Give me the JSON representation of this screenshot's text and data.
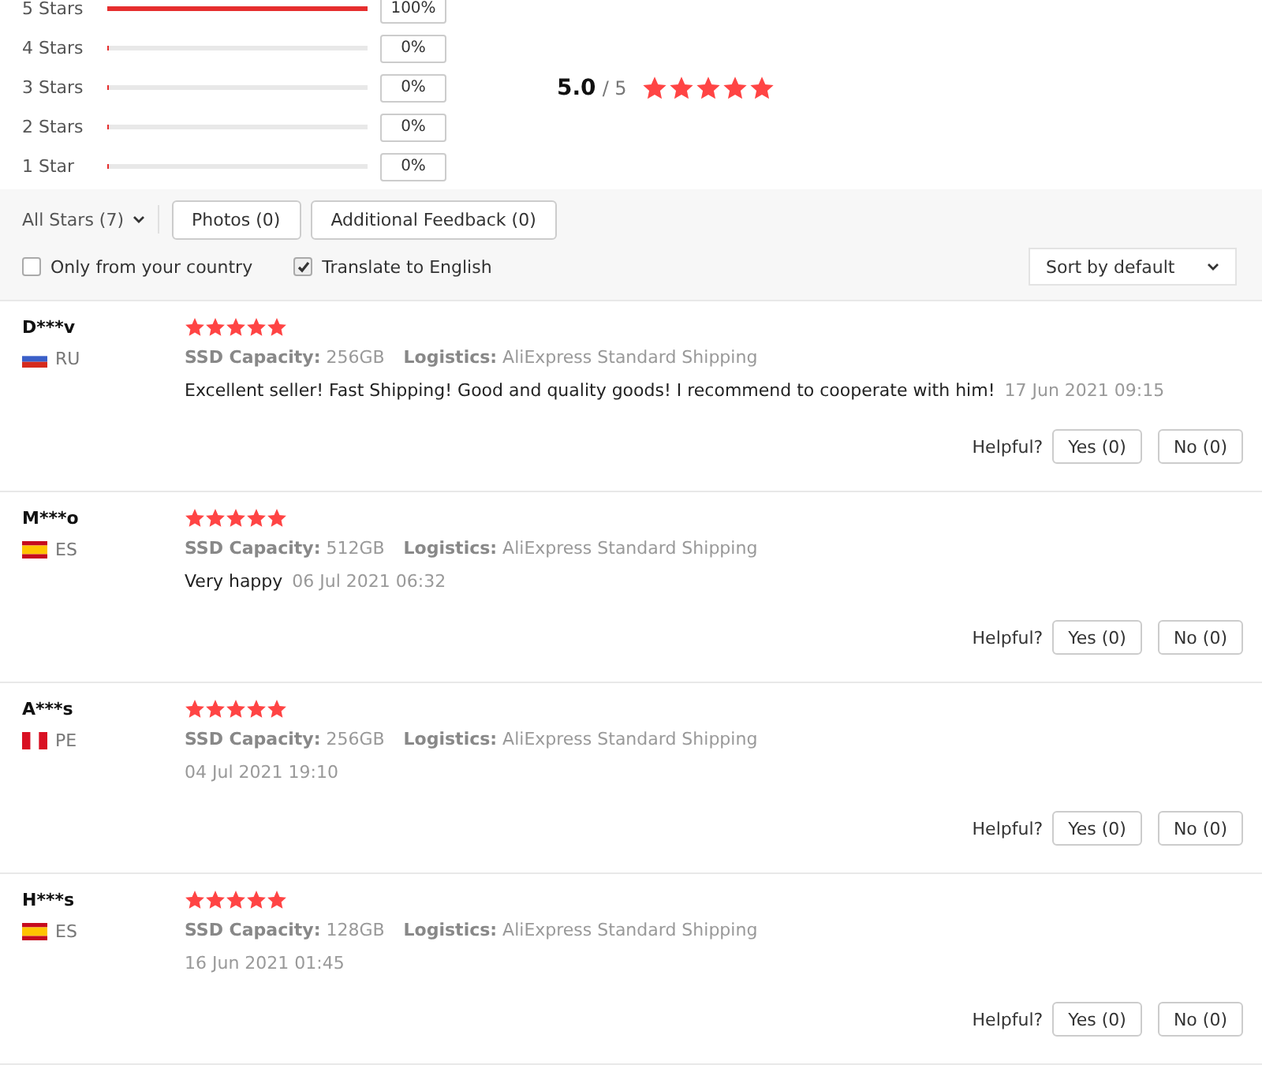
{
  "distribution": [
    {
      "label": "5 Stars",
      "level": 1,
      "percent": "100%"
    },
    {
      "label": "4 Stars",
      "level": 0,
      "percent": "0%"
    },
    {
      "label": "3 Stars",
      "level": 0,
      "percent": "0%"
    },
    {
      "label": "2 Stars",
      "level": 0,
      "percent": "0%"
    },
    {
      "label": "1 Star",
      "level": 0,
      "percent": "0%"
    }
  ],
  "average": {
    "score": "5.0",
    "out_of": "/ 5",
    "stars": 5
  },
  "filters": {
    "dropdown": "All Stars (7)",
    "buttons": [
      "Photos (0)",
      "Additional Feedback (0)"
    ],
    "checkboxes": [
      {
        "label": "Only from your country",
        "checked": false
      },
      {
        "label": "Translate to English",
        "checked": true
      }
    ],
    "sort": "Sort by default"
  },
  "reviews": [
    {
      "name": "D***v",
      "kind": "russia",
      "country": "RU",
      "stars": 5,
      "attributes": [
        {
          "label": "SSD Capacity:",
          "value": "256GB"
        },
        {
          "label": "Logistics:",
          "value": "AliExpress Standard Shipping"
        }
      ],
      "text": "Excellent seller! Fast Shipping! Good and quality goods! I recommend to cooperate with him!",
      "date": "17 Jun 2021 09:15",
      "helpful": "Helpful?",
      "yes": "Yes (0)",
      "no": "No (0)"
    },
    {
      "name": "M***o",
      "kind": "spain",
      "country": "ES",
      "stars": 5,
      "attributes": [
        {
          "label": "SSD Capacity:",
          "value": "512GB"
        },
        {
          "label": "Logistics:",
          "value": "AliExpress Standard Shipping"
        }
      ],
      "text": "Very happy",
      "date": "06 Jul 2021 06:32",
      "helpful": "Helpful?",
      "yes": "Yes (0)",
      "no": "No (0)"
    },
    {
      "name": "A***s",
      "kind": "peru",
      "country": "PE",
      "stars": 5,
      "attributes": [
        {
          "label": "SSD Capacity:",
          "value": "256GB"
        },
        {
          "label": "Logistics:",
          "value": "AliExpress Standard Shipping"
        }
      ],
      "date": "04 Jul 2021 19:10",
      "helpful": "Helpful?",
      "yes": "Yes (0)",
      "no": "No (0)"
    },
    {
      "name": "H***s",
      "kind": "spain",
      "country": "ES",
      "stars": 5,
      "attributes": [
        {
          "label": "SSD Capacity:",
          "value": "128GB"
        },
        {
          "label": "Logistics:",
          "value": "AliExpress Standard Shipping"
        }
      ],
      "date": "16 Jun 2021 01:45",
      "helpful": "Helpful?",
      "yes": "Yes (0)",
      "no": "No (0)"
    }
  ]
}
